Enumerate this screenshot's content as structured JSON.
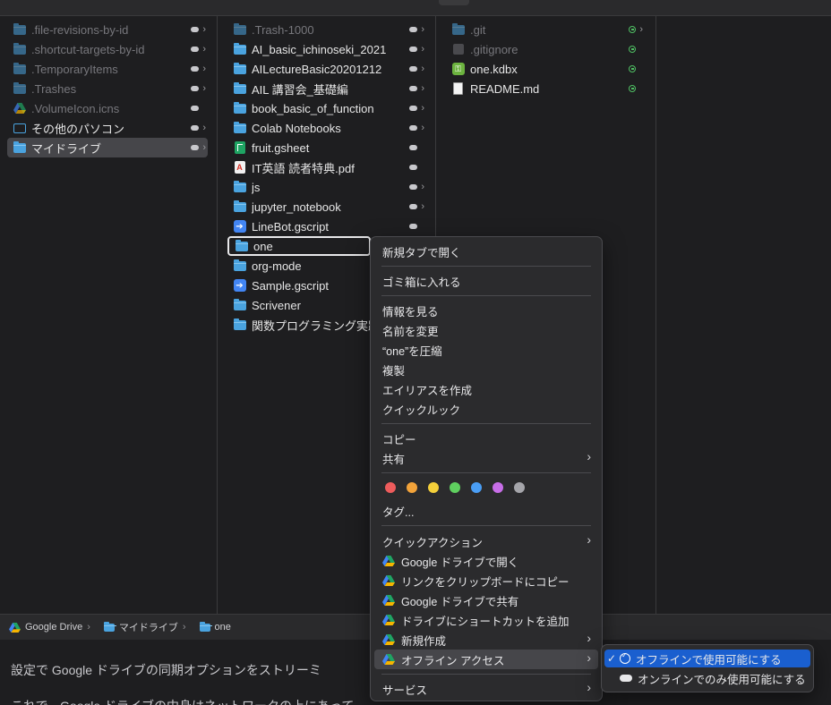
{
  "col1": [
    {
      "label": ".file-revisions-by-id",
      "icon": "folder-icon"
    },
    {
      "label": ".shortcut-targets-by-id",
      "icon": "folder-icon"
    },
    {
      "label": ".TemporaryItems",
      "icon": "folder-icon"
    },
    {
      "label": ".Trashes",
      "icon": "folder-icon"
    },
    {
      "label": ".VolumeIcon.icns",
      "icon": "google-drive-icon"
    },
    {
      "label": "その他のパソコン",
      "icon": "computer-icon"
    },
    {
      "label": "マイドライブ",
      "icon": "folder-icon"
    }
  ],
  "col2": [
    {
      "label": ".Trash-1000",
      "icon": "folder-icon"
    },
    {
      "label": "AI_basic_ichinoseki_2021",
      "icon": "folder-icon"
    },
    {
      "label": "AILectureBasic20201212",
      "icon": "folder-icon"
    },
    {
      "label": "AIL 講習会_基礎編",
      "icon": "folder-icon"
    },
    {
      "label": "book_basic_of_function",
      "icon": "folder-icon"
    },
    {
      "label": "Colab Notebooks",
      "icon": "folder-icon"
    },
    {
      "label": "fruit.gsheet",
      "icon": "gsheet-icon"
    },
    {
      "label": "IT英語 読者特典.pdf",
      "icon": "pdf-icon"
    },
    {
      "label": "js",
      "icon": "folder-icon"
    },
    {
      "label": "jupyter_notebook",
      "icon": "folder-icon"
    },
    {
      "label": "LineBot.gscript",
      "icon": "gscript-icon"
    },
    {
      "label": "one",
      "icon": "folder-icon"
    },
    {
      "label": "org-mode",
      "icon": "folder-icon"
    },
    {
      "label": "Sample.gscript",
      "icon": "gscript-icon"
    },
    {
      "label": "Scrivener",
      "icon": "folder-icon"
    },
    {
      "label": "関数プログラミング実践",
      "icon": "folder-icon"
    }
  ],
  "col3": [
    {
      "label": ".git",
      "icon": "folder-icon"
    },
    {
      "label": ".gitignore",
      "icon": "file-icon"
    },
    {
      "label": "one.kdbx",
      "icon": "keepass-icon"
    },
    {
      "label": "README.md",
      "icon": "document-icon"
    }
  ],
  "pathbar": {
    "items": [
      "Google Drive",
      "マイドライブ",
      "one"
    ],
    "sep": "›"
  },
  "background_doc": {
    "line1": "設定で Google ドライブの同期オプションをストリーミ",
    "line2": "これで、Google ドライブの中身はネットワークの上にあって"
  },
  "context_menu": {
    "open_new_tab": "新規タブで開く",
    "move_to_trash": "ゴミ箱に入れる",
    "get_info": "情報を見る",
    "rename": "名前を変更",
    "compress": "“one”を圧縮",
    "duplicate": "複製",
    "make_alias": "エイリアスを作成",
    "quick_look": "クイックルック",
    "copy": "コピー",
    "share": "共有",
    "tag_colors": [
      "#ee5c5c",
      "#f2a33a",
      "#f4cf3a",
      "#5fcf5f",
      "#4a9ef5",
      "#c86ee8",
      "#a5a5aa"
    ],
    "tags": "タグ...",
    "quick_actions": "クイックアクション",
    "gd_open": "Google ドライブで開く",
    "gd_copy_link": "リンクをクリップボードにコピー",
    "gd_share": "Google ドライブで共有",
    "gd_add_shortcut": "ドライブにショートカットを追加",
    "gd_new": "新規作成",
    "gd_offline": "オフライン アクセス",
    "services": "サービス",
    "submenu_arrow": "›"
  },
  "submenu": {
    "check": "✓",
    "make_offline": "オフラインで使用可能にする",
    "online_only": "オンラインでのみ使用可能にする"
  },
  "colors": {
    "selection_blue": "#1a5fcf",
    "folder_blue": "#4aa3df",
    "synced_green": "#4fbf63"
  }
}
